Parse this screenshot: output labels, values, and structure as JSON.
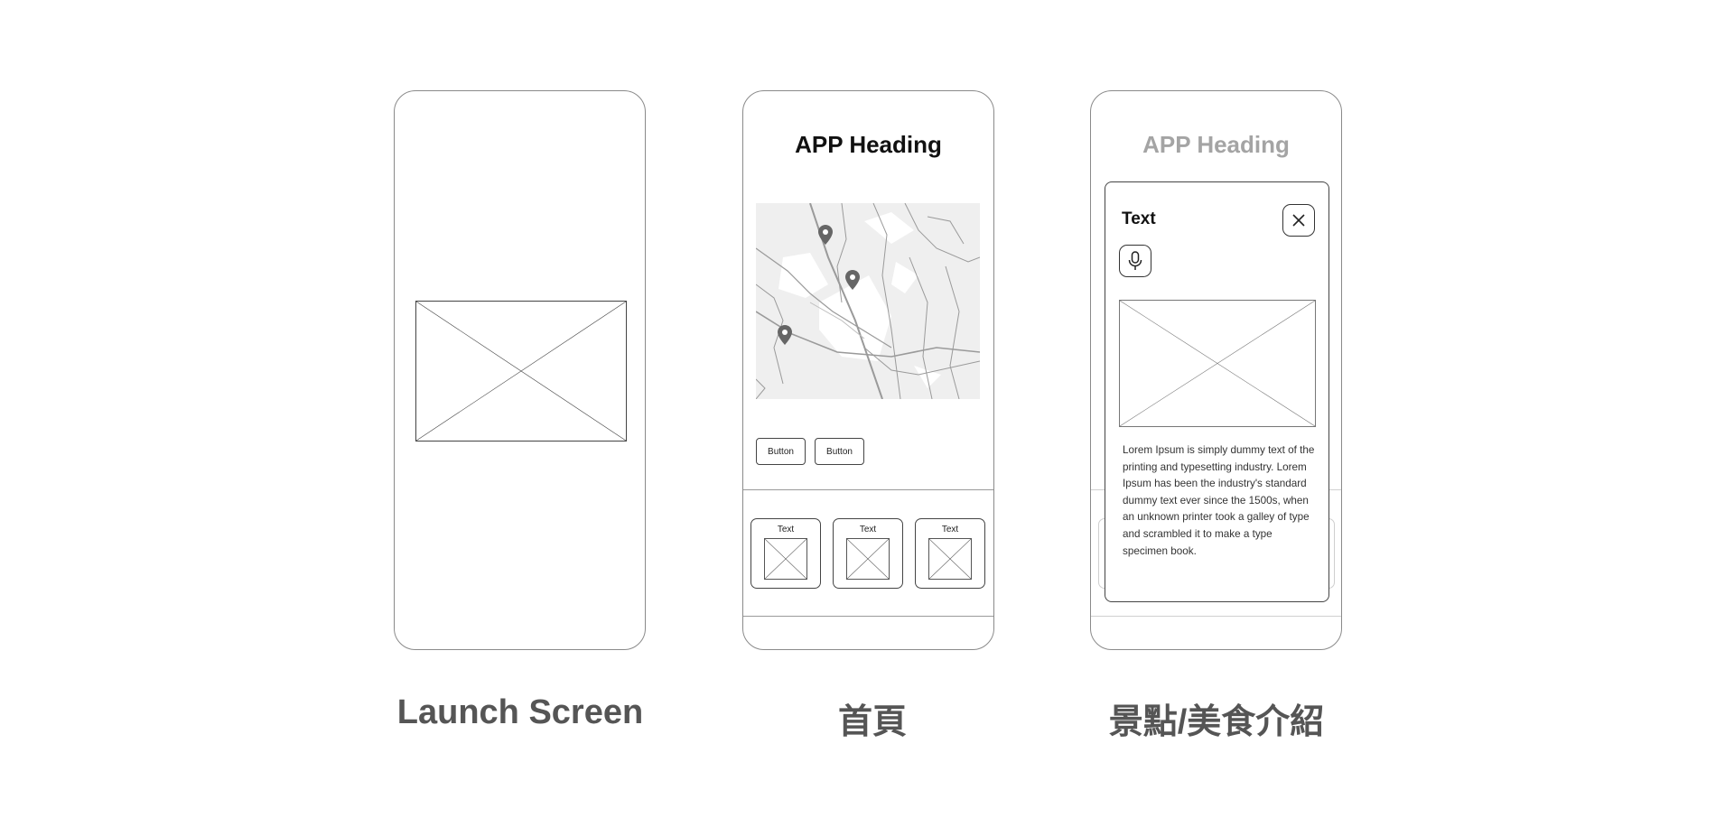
{
  "screens": {
    "launch": {
      "caption": "Launch Screen"
    },
    "home": {
      "caption": "首頁",
      "heading": "APP Heading",
      "map_pins": [
        "map-pin-icon",
        "map-pin-icon",
        "map-pin-icon"
      ],
      "buttons": [
        "Button",
        "Button"
      ],
      "cards": [
        {
          "label": "Text"
        },
        {
          "label": "Text"
        },
        {
          "label": "Text"
        }
      ]
    },
    "detail": {
      "caption": "景點/美食介紹",
      "heading": "APP Heading",
      "modal": {
        "title": "Text",
        "close_icon": "close-icon",
        "mic_icon": "microphone-icon",
        "body": "Lorem Ipsum is simply dummy text of the printing and typesetting industry. Lorem Ipsum has been the industry's standard dummy text ever since the 1500s, when an unknown printer took a galley of type and scrambled it to make a type specimen book."
      }
    }
  },
  "colors": {
    "frame_border": "#8a8a8a",
    "caption_text": "#555555",
    "muted_heading": "#a4a4a4",
    "map_background": "#efefef",
    "map_pin": "#666666"
  }
}
